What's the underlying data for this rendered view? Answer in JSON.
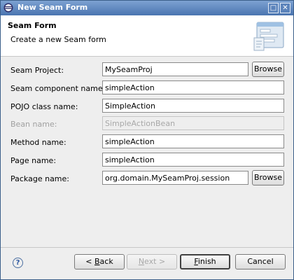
{
  "window": {
    "title": "New Seam Form",
    "maximize_glyph": "□",
    "close_glyph": "✕",
    "icon": "eclipse-icon"
  },
  "header": {
    "title": "Seam Form",
    "description": "Create a new Seam form",
    "banner_icon": "form-wizard-icon"
  },
  "form": {
    "seam_project": {
      "label": "Seam Project:",
      "value": "MySeamProj",
      "browse": "Browse"
    },
    "component_name": {
      "label": "Seam component name:",
      "value": "simpleAction"
    },
    "pojo_class": {
      "label": "POJO class name:",
      "value": "SimpleAction"
    },
    "bean_name": {
      "label": "Bean name:",
      "value": "SimpleActionBean"
    },
    "method_name": {
      "label": "Method name:",
      "value": "simpleAction"
    },
    "page_name": {
      "label": "Page name:",
      "value": "simpleAction"
    },
    "package_name": {
      "label": "Package name:",
      "value": "org.domain.MySeamProj.session",
      "browse": "Browse"
    }
  },
  "footer": {
    "help_glyph": "?",
    "back": {
      "prefix": "< ",
      "mnemonic": "B",
      "rest": "ack"
    },
    "next": {
      "mnemonic": "N",
      "rest": "ext >"
    },
    "finish": {
      "mnemonic": "F",
      "rest": "inish"
    },
    "cancel": "Cancel"
  }
}
